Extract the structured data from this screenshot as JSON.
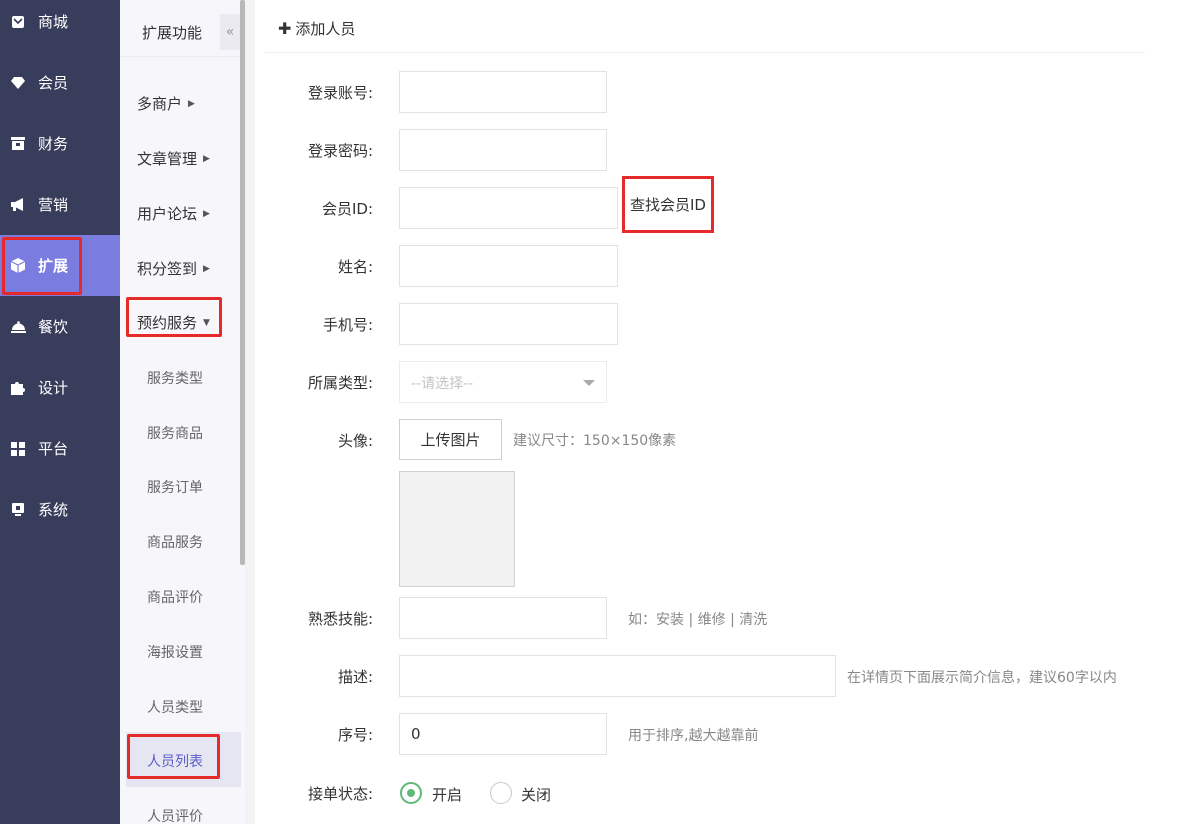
{
  "nav": {
    "items": [
      {
        "label": "商城",
        "icon": "envelope-icon"
      },
      {
        "label": "会员",
        "icon": "diamond-icon"
      },
      {
        "label": "财务",
        "icon": "cash-icon"
      },
      {
        "label": "营销",
        "icon": "megaphone-icon"
      },
      {
        "label": "扩展",
        "icon": "cube-icon",
        "active": true
      },
      {
        "label": "餐饮",
        "icon": "dish-icon"
      },
      {
        "label": "设计",
        "icon": "puzzle-icon"
      },
      {
        "label": "平台",
        "icon": "grid-icon"
      },
      {
        "label": "系统",
        "icon": "monitor-icon"
      }
    ]
  },
  "sub": {
    "title": "扩展功能",
    "collapse": "«",
    "groups": [
      "多商户",
      "文章管理",
      "用户论坛",
      "积分签到",
      "预约服务"
    ],
    "items": [
      "服务类型",
      "服务商品",
      "服务订单",
      "商品服务",
      "商品评价",
      "海报设置",
      "人员类型",
      "人员列表",
      "人员评价"
    ]
  },
  "main": {
    "header": "添加人员",
    "fields": {
      "account_label": "登录账号:",
      "password_label": "登录密码:",
      "member_id_label": "会员ID:",
      "find_member_btn": "查找会员ID",
      "name_label": "姓名:",
      "phone_label": "手机号:",
      "type_label": "所属类型:",
      "type_placeholder": "--请选择--",
      "avatar_label": "头像:",
      "upload_btn": "上传图片",
      "avatar_hint": "建议尺寸：150×150像素",
      "skills_label": "熟悉技能:",
      "skills_hint": "如：安装 | 维修 | 清洗",
      "desc_label": "描述:",
      "desc_hint": "在详情页下面展示简介信息，建议60字以内",
      "order_label": "序号:",
      "order_value": "0",
      "order_hint": "用于排序,越大越靠前",
      "status_label": "接单状态:",
      "status_on": "开启",
      "status_off": "关闭"
    }
  },
  "colors": {
    "nav_bg": "#393d5c",
    "active_bg": "#7a7ce0",
    "highlight": "#e62a2a",
    "radio_green": "#5fb878"
  }
}
